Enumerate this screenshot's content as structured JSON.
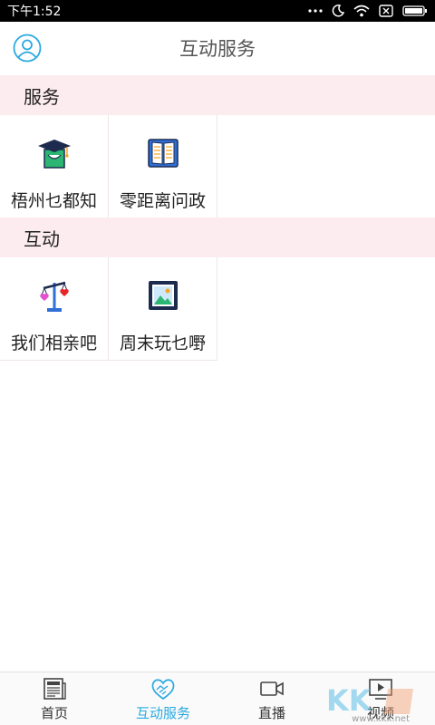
{
  "status_bar": {
    "time": "下午1:52"
  },
  "header": {
    "title": "互动服务"
  },
  "sections": [
    {
      "title": "服务",
      "items": [
        {
          "label": "梧州乜都知",
          "icon": "graduation-cap-icon"
        },
        {
          "label": "零距离问政",
          "icon": "open-book-icon"
        }
      ]
    },
    {
      "title": "互动",
      "items": [
        {
          "label": "我们相亲吧",
          "icon": "balance-hearts-icon"
        },
        {
          "label": "周末玩乜嘢",
          "icon": "landscape-picture-icon"
        }
      ]
    }
  ],
  "tabs": [
    {
      "label": "首页",
      "icon": "newspaper-icon",
      "active": false
    },
    {
      "label": "互动服务",
      "icon": "heart-handshake-icon",
      "active": true
    },
    {
      "label": "直播",
      "icon": "video-camera-icon",
      "active": false
    },
    {
      "label": "视频",
      "icon": "play-screen-icon",
      "active": false
    }
  ],
  "watermark": {
    "text": "www.kkx.net"
  },
  "colors": {
    "accent": "#29a9e1",
    "section_bg": "#fdecef"
  }
}
